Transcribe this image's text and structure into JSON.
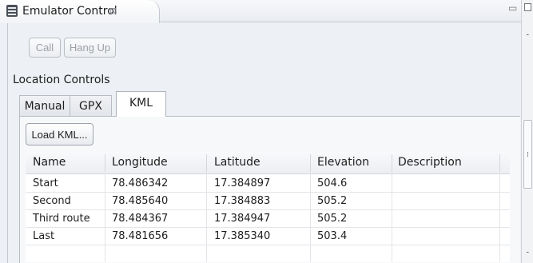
{
  "view": {
    "title": "Emulator Control",
    "close_glyph": "⊠"
  },
  "telephony": {
    "call_label": "Call",
    "hangup_label": "Hang Up"
  },
  "location": {
    "section_label": "Location Controls",
    "tabs": [
      {
        "label": "Manual",
        "selected": false
      },
      {
        "label": "GPX",
        "selected": false
      },
      {
        "label": "KML",
        "selected": true
      }
    ],
    "load_button_label": "Load KML...",
    "table": {
      "columns": [
        "Name",
        "Longitude",
        "Latitude",
        "Elevation",
        "Description"
      ],
      "rows": [
        [
          "Start",
          "78.486342",
          "17.384897",
          "504.6",
          ""
        ],
        [
          "Second",
          "78.485640",
          "17.384883",
          "505.2",
          ""
        ],
        [
          "Third route",
          "78.484367",
          "17.384947",
          "505.2",
          ""
        ],
        [
          "Last",
          "78.481656",
          "17.385340",
          "503.4",
          ""
        ]
      ]
    }
  },
  "icons": [
    "emulator-view-icon",
    "close-icon",
    "maximize-icon",
    "sash-handle-icon"
  ]
}
